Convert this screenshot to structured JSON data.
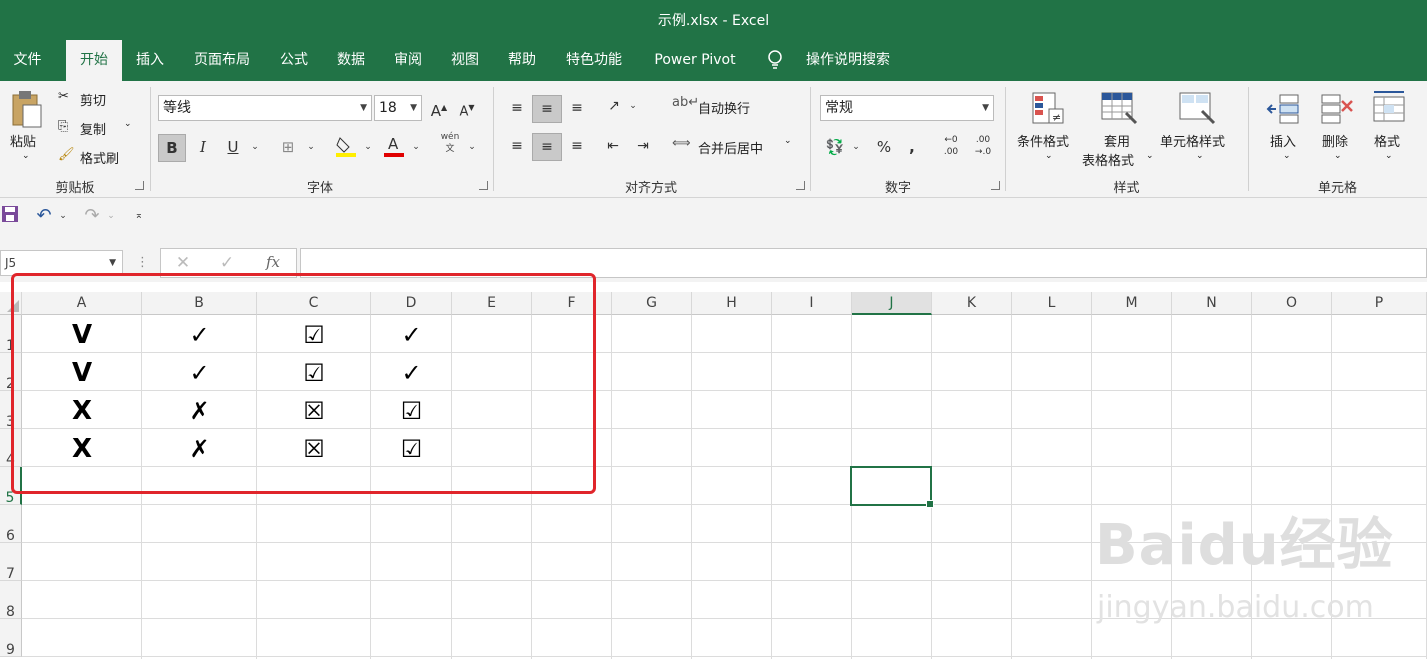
{
  "window": {
    "title": "示例.xlsx  -  Excel"
  },
  "menu": {
    "tabs": [
      "文件",
      "开始",
      "插入",
      "页面布局",
      "公式",
      "数据",
      "审阅",
      "视图",
      "帮助",
      "特色功能",
      "Power Pivot"
    ],
    "active_tab": "开始",
    "tell_me": "操作说明搜索"
  },
  "ribbon": {
    "clipboard": {
      "paste": "粘贴",
      "cut": "剪切",
      "copy": "复制",
      "format_painter": "格式刷",
      "label": "剪贴板"
    },
    "font": {
      "name": "等线",
      "size": "18",
      "bold": "B",
      "italic": "I",
      "underline": "U",
      "wen": "wén",
      "label": "字体"
    },
    "alignment": {
      "wrap_text": "自动换行",
      "merge_center": "合并后居中",
      "label": "对齐方式"
    },
    "number": {
      "format": "常规",
      "percent": "%",
      "comma": ",",
      "label": "数字"
    },
    "styles": {
      "conditional": "条件格式",
      "table_line1": "套用",
      "table_line2": "表格格式",
      "cell_styles": "单元格样式",
      "label": "样式"
    },
    "cells": {
      "insert": "插入",
      "delete": "删除",
      "format": "格式",
      "label": "单元格"
    }
  },
  "formula_bar": {
    "name_box": "J5",
    "fx": "fx",
    "value": ""
  },
  "sheet": {
    "columns": [
      "A",
      "B",
      "C",
      "D",
      "E",
      "F",
      "G",
      "H",
      "I",
      "J",
      "K",
      "L",
      "M",
      "N",
      "O",
      "P"
    ],
    "selected_column": "J",
    "rows": [
      "1",
      "2",
      "3",
      "4",
      "5",
      "6",
      "7",
      "8",
      "9"
    ],
    "selected_row": "5",
    "cells": {
      "A1": "V",
      "B1": "✓",
      "C1": "☑",
      "D1": "✓",
      "A2": "V",
      "B2": "✓",
      "C2": "☑",
      "D2": "✓",
      "A3": "X",
      "B3": "✗",
      "C3": "☒",
      "D3": "☑",
      "A4": "X",
      "B4": "✗",
      "C4": "☒",
      "D4": "☑"
    }
  },
  "watermark": {
    "main": "Baidu经验",
    "sub": "jingyan.baidu.com"
  },
  "colors": {
    "excel_green": "#217346",
    "highlight_red": "#e0252b"
  }
}
